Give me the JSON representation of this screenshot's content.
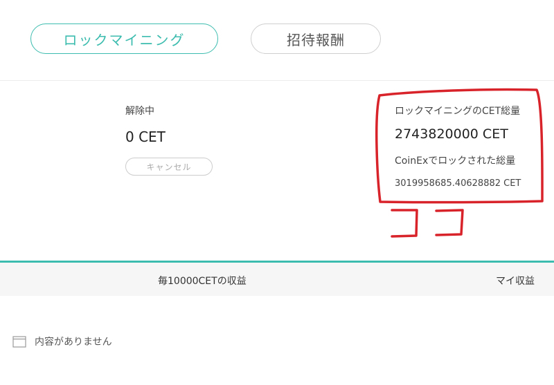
{
  "tabs": {
    "lock_mining": "ロックマイニング",
    "invite_reward": "招待報酬"
  },
  "unlocking": {
    "label": "解除中",
    "value": "0 CET",
    "cancel_label": "キャンセル"
  },
  "totals": {
    "lock_total_label": "ロックマイニングのCET総量",
    "lock_total_value": "2743820000 CET",
    "coinex_total_label": "CoinExでロックされた総量",
    "coinex_total_value": "3019958685.40628882 CET"
  },
  "annotation": {
    "text": "ココ",
    "color": "#d9232a"
  },
  "table": {
    "col_earnings": "毎10000CETの収益",
    "col_my_earnings": "マイ収益",
    "empty_text": "内容がありません"
  },
  "colors": {
    "accent": "#3cbcae",
    "header_bg": "#f6f6f6"
  },
  "icons": {
    "empty": "empty-box-icon"
  }
}
